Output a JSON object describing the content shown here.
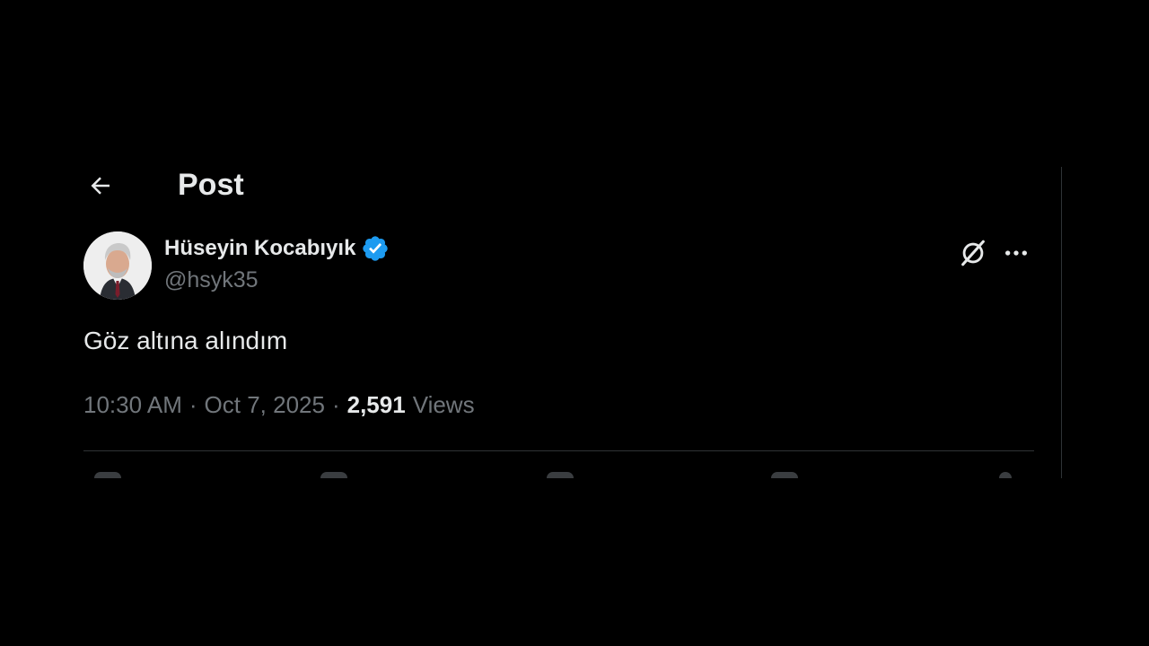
{
  "header": {
    "title": "Post",
    "back_icon": "arrow-left-icon"
  },
  "author": {
    "display_name": "Hüseyin Kocabıyık",
    "handle": "@hsyk35",
    "verified": true,
    "verified_color": "#1d9bf0"
  },
  "post": {
    "text": "Göz altına alındım",
    "time": "10:30 AM",
    "date": "Oct 7, 2025",
    "views_count": "2,591",
    "views_label": "Views"
  },
  "top_actions": {
    "grok_icon": "grok-icon",
    "more_icon": "more-horizontal-icon"
  },
  "actions": [
    "reply-icon",
    "repost-icon",
    "like-icon",
    "bookmark-icon",
    "share-icon"
  ],
  "colors": {
    "background": "#000000",
    "primary_text": "#e7e9ea",
    "secondary_text": "#71767b",
    "border": "#2f3336",
    "accent": "#1d9bf0"
  }
}
